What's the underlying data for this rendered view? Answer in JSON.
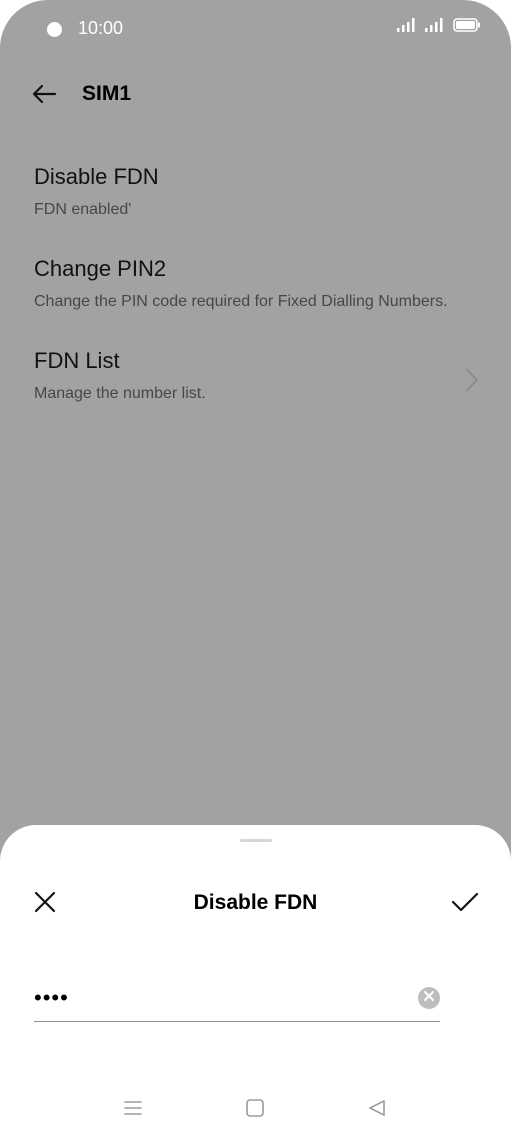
{
  "status_bar": {
    "time": "10:00"
  },
  "header": {
    "title": "SIM1"
  },
  "settings": {
    "items": [
      {
        "title": "Disable FDN",
        "subtitle": "FDN enabled'"
      },
      {
        "title": "Change PIN2",
        "subtitle": "Change the PIN code required for Fixed Dialling Numbers."
      },
      {
        "title": "FDN List",
        "subtitle": "Manage the number list."
      }
    ]
  },
  "dialog": {
    "title": "Disable FDN",
    "pin_value": "••••"
  },
  "icons": {
    "back": "arrow-left-icon",
    "chevron": "chevron-right-icon",
    "close": "close-icon",
    "confirm": "checkmark-icon",
    "clear": "clear-circle-icon",
    "menu": "menu-icon",
    "home": "home-square-icon",
    "back_nav": "back-triangle-icon"
  },
  "colors": {
    "overlay_background": "#a2a2a2",
    "accent_underline": "#2bbf8a",
    "sheet_background": "#ffffff"
  }
}
